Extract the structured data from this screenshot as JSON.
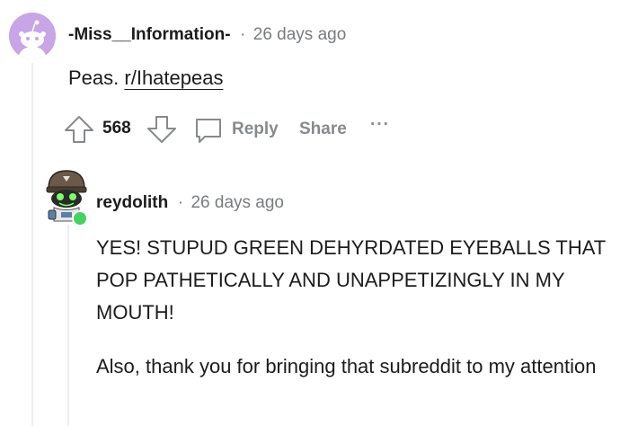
{
  "comment1": {
    "username": "-Miss__Information-",
    "separator": "·",
    "timestamp": "26 days ago",
    "body_prefix": "Peas.",
    "subreddit_link": "r/Ihatepeas",
    "score": "568",
    "reply_label": "Reply",
    "share_label": "Share",
    "more_label": "···"
  },
  "comment2": {
    "username": "reydolith",
    "separator": "·",
    "timestamp": "26 days ago",
    "paragraph1": "YES! STUPUD GREEN DEHYRDATED EYEBALLS THAT POP PATHETICALLY AND UNAPPETIZINGLY IN MY MOUTH!",
    "paragraph2": "Also, thank you for bringing that subreddit to my attention",
    "online_status_color": "#46d160"
  },
  "colors": {
    "meta": "#787c7e",
    "action": "#878a8c",
    "text": "#1c1c1c",
    "avatar_bg": "#c7a5e6"
  }
}
